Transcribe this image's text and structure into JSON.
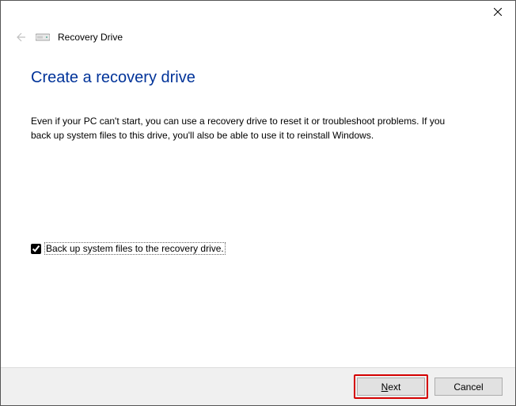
{
  "window": {
    "title": "Recovery Drive"
  },
  "heading": "Create a recovery drive",
  "body": "Even if your PC can't start, you can use a recovery drive to reset it or troubleshoot problems. If you back up system files to this drive, you'll also be able to use it to reinstall Windows.",
  "checkbox": {
    "label": "Back up system files to the recovery drive.",
    "checked": true
  },
  "buttons": {
    "next": "Next",
    "cancel": "Cancel"
  }
}
